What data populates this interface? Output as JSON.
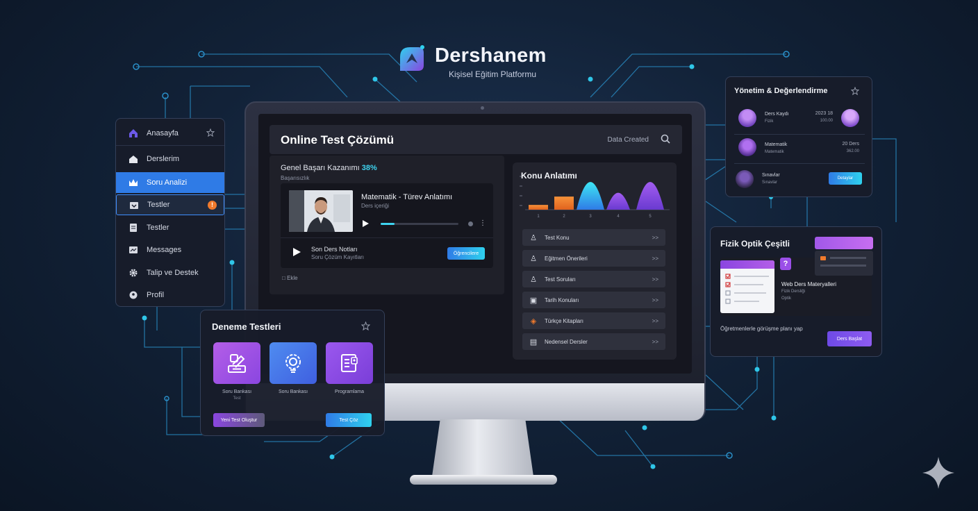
{
  "brand": {
    "name": "Dershanem",
    "tagline": "Kişisel Eğitim Platformu"
  },
  "sidebar": {
    "items": [
      {
        "label": "Anasayfa",
        "icon": "home-icon"
      },
      {
        "label": "Derslerim",
        "icon": "house-icon"
      },
      {
        "label": "Soru Analizi",
        "icon": "crown-icon"
      },
      {
        "label": "Testler",
        "icon": "box-icon",
        "badge": "!"
      },
      {
        "label": "Testler",
        "icon": "document-icon"
      },
      {
        "label": "Messages",
        "icon": "message-icon"
      },
      {
        "label": "Talip ve Destek",
        "icon": "gear-icon"
      },
      {
        "label": "Profil",
        "icon": "profile-icon"
      }
    ]
  },
  "screen": {
    "title": "Online Test Çözümü",
    "search_label": "Data Created",
    "progress_label": "Genel Başarı Kazanımı",
    "progress_value": "38%",
    "progress_fraction": 0.38,
    "progress_sub": "Başarısızlık",
    "video_title": "Matematik - Türev Anlatımı",
    "video_sub": "Ders içeriği",
    "video_progress": 0.18,
    "next_title": "Son Ders Notları",
    "next_sub": "Soru Çözüm Kayıtları",
    "next_button": "Öğrencilere",
    "footer": "Ekle"
  },
  "konu": {
    "title": "Konu Anlatımı",
    "items": [
      {
        "label": "Test Konu",
        "icon": "person-icon"
      },
      {
        "label": "Eğitmen Önerileri",
        "icon": "person-icon"
      },
      {
        "label": "Test Soruları",
        "icon": "person-icon"
      },
      {
        "label": "Tarih Konuları",
        "icon": "book-icon"
      },
      {
        "label": "Türkçe Kitapları",
        "icon": "palette-icon"
      },
      {
        "label": "Nedensel Dersler",
        "icon": "car-icon"
      }
    ]
  },
  "chart_data": {
    "type": "bar",
    "categories": [
      "1",
      "2",
      "3",
      "4",
      "5"
    ],
    "values": [
      8,
      22,
      62,
      38,
      62
    ],
    "tick_labels": [
      "1",
      "2",
      "3",
      "4",
      "5"
    ],
    "ylim": [
      0,
      70
    ],
    "colors": [
      "#f07a2c",
      "#f07a2c",
      "#3ed4f0",
      "#8a46e0",
      "#8a46e0"
    ]
  },
  "deneme": {
    "title": "Deneme Testleri",
    "tiles": [
      {
        "label": "Soru Bankası",
        "sub": "Test",
        "icon": "exam-icon",
        "color": "#9b4fe8"
      },
      {
        "label": "Soru Bankası",
        "sub": "",
        "icon": "lightbulb-gear-icon",
        "color": "#3f6fe6"
      },
      {
        "label": "Programlama",
        "sub": "",
        "icon": "checklist-icon",
        "color": "#8a46e0"
      }
    ],
    "btn_left": "Yeni Test Oluştur",
    "btn_right": "Test Çöz"
  },
  "yonetim": {
    "title": "Yönetim & Değerlendirme",
    "rows": [
      {
        "name": "Ders Kaydı",
        "sub": "Fizik",
        "val": "2023 18",
        "val2": "100.00"
      },
      {
        "name": "Matematik",
        "sub": "Matematik",
        "val": "20 Ders",
        "val2": "362.00"
      },
      {
        "name": "Sınavlar",
        "sub": "Sınavlar",
        "val": "",
        "val2": ""
      }
    ],
    "button": "Detaylar"
  },
  "fizik": {
    "title": "Fizik Optik Çeşitli",
    "widget_title": "Web Ders Materyalleri",
    "widget_sub": "Fizik Dersliği",
    "widget_sub2": "Optik",
    "text": "Öğretmenlerle görüşme planı yap",
    "button": "Ders Başlat"
  }
}
